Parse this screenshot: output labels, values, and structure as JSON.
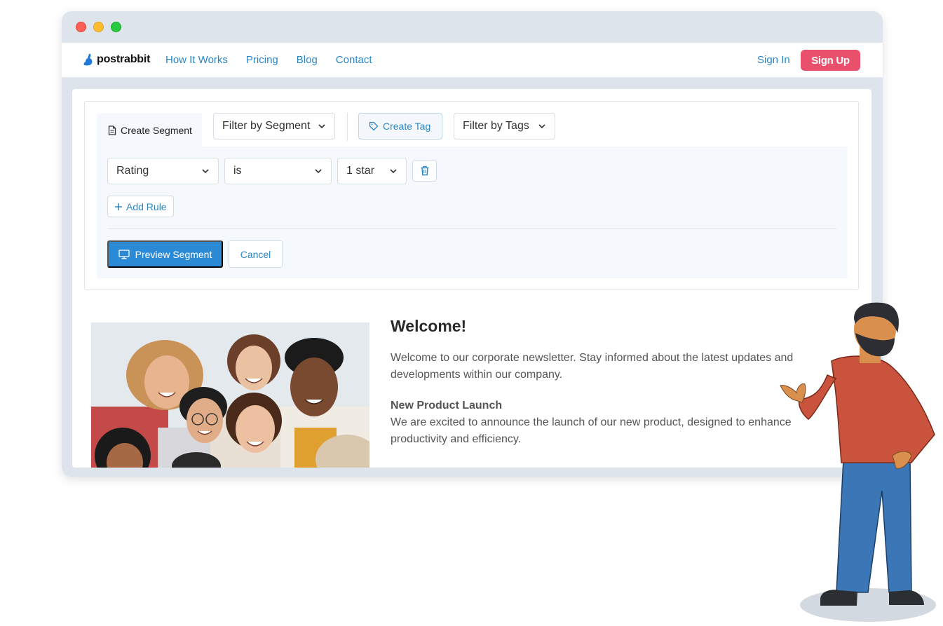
{
  "brand": {
    "name": "postrabbit"
  },
  "nav": {
    "links": [
      "How It Works",
      "Pricing",
      "Blog",
      "Contact"
    ],
    "signin": "Sign In",
    "signup": "Sign Up"
  },
  "segment": {
    "create_tab": "Create Segment",
    "filter_segment": "Filter by Segment",
    "create_tag": "Create Tag",
    "filter_tags": "Filter by Tags",
    "rule": {
      "field": "Rating",
      "operator": "is",
      "value": "1 star"
    },
    "add_rule": "Add Rule",
    "preview": "Preview Segment",
    "cancel": "Cancel"
  },
  "article": {
    "title": "Welcome!",
    "intro": "Welcome to our corporate newsletter. Stay informed about the latest updates and developments within our company.",
    "subtitle": "New Product Launch",
    "body": "We are excited to announce the launch of our new product, designed to enhance productivity and efficiency."
  },
  "colors": {
    "accent": "#2b86c5",
    "signup": "#e8506c",
    "primary_button": "#2b8ad6"
  }
}
